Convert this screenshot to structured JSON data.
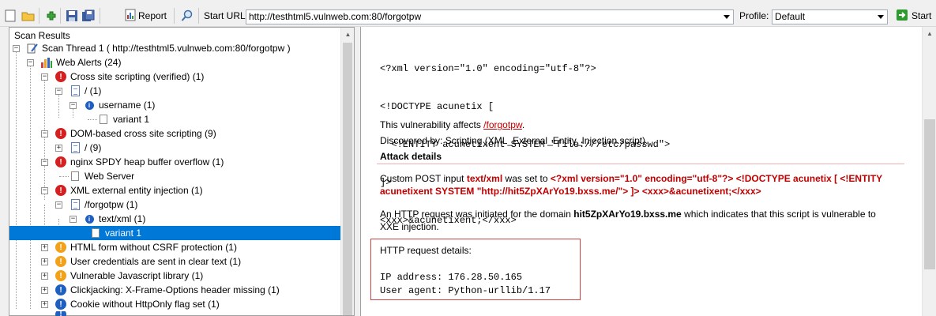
{
  "toolbar": {
    "report_label": "Report",
    "start_url_label": "Start URL:",
    "start_url_value": "http://testhtml5.vulnweb.com:80/forgotpw",
    "profile_label": "Profile:",
    "profile_value": "Default",
    "start_label": "Start",
    "icons": [
      "new-scan-icon",
      "open-icon",
      "plugin-icon",
      "save-icon",
      "save-all-icon",
      "report-icon",
      "search-icon",
      "start-icon"
    ]
  },
  "tree": {
    "title": "Scan Results",
    "nodes": [
      {
        "label": "Scan Thread 1 ( http://testhtml5.vulnweb.com:80/forgotpw )"
      },
      {
        "label": "Web Alerts (24)"
      },
      {
        "label": "Cross site scripting (verified) (1)"
      },
      {
        "label": "/ (1)"
      },
      {
        "label": "username (1)"
      },
      {
        "label": "variant 1"
      },
      {
        "label": "DOM-based cross site scripting (9)"
      },
      {
        "label": "/ (9)"
      },
      {
        "label": "nginx SPDY heap buffer overflow (1)"
      },
      {
        "label": "Web Server"
      },
      {
        "label": "XML external entity injection (1)"
      },
      {
        "label": "/forgotpw (1)"
      },
      {
        "label": "text/xml (1)"
      },
      {
        "label": "variant 1"
      },
      {
        "label": "HTML form without CSRF protection (1)"
      },
      {
        "label": "User credentials are sent in clear text (1)"
      },
      {
        "label": "Vulnerable Javascript library (1)"
      },
      {
        "label": "Clickjacking: X-Frame-Options header missing (1)"
      },
      {
        "label": "Cookie without HttpOnly flag set (1)"
      }
    ]
  },
  "detail": {
    "xml_lines": [
      "<?xml version=\"1.0\" encoding=\"utf-8\"?>",
      "<!DOCTYPE acunetix [",
      "  <!ENTITY acunetixent SYSTEM \"file:///etc/passwd\">",
      "]>",
      "<xxx>&acunetixent;</xxx>"
    ],
    "affects_prefix": "This vulnerability affects ",
    "affects_link": "/forgotpw",
    "affects_suffix": ".",
    "discovered_by": "Discovered by: Scripting (XML_External_Entity_Injection.script).",
    "attack_details_heading": "Attack details",
    "custom_post_prefix": "Custom POST input ",
    "custom_post_param": "text/xml",
    "custom_post_mid": " was set to ",
    "custom_post_value_line1": "<?xml version=\"1.0\" encoding=\"utf-8\"?> <!DOCTYPE acunetix [ <!ENTITY",
    "custom_post_value_line2": "acunetixent SYSTEM \"http://hit5ZpXArYo19.bxss.me/\"> ]> <xxx>&acunetixent;</xxx>",
    "http_initiated_prefix": "An HTTP request was initiated for the domain ",
    "http_initiated_domain": "hit5ZpXArYo19.bxss.me",
    "http_initiated_suffix": " which indicates that this script is vulnerable to",
    "http_initiated_line2": "XXE injection.",
    "http_request_details_label": "HTTP request details:",
    "ip_address_line": "IP address: 176.28.50.165",
    "user_agent_line": "User agent: Python-urllib/1.17"
  }
}
